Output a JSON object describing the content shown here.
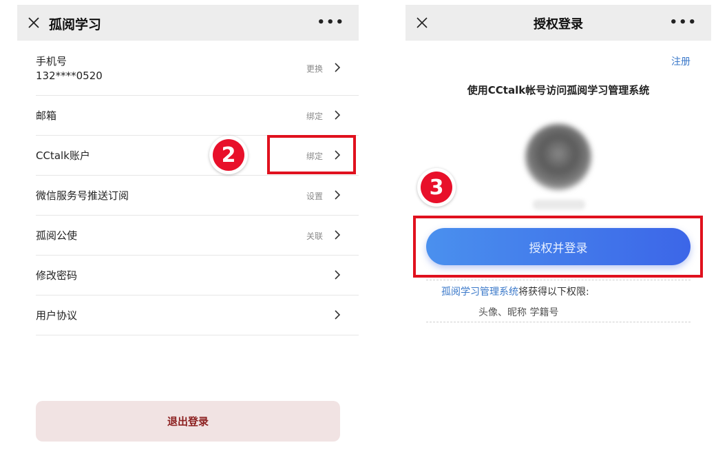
{
  "left": {
    "title": "孤阅学习",
    "more": "•••",
    "rows": [
      {
        "label": "手机号",
        "sub": "132****0520",
        "action": "更换"
      },
      {
        "label": "邮箱",
        "action": "绑定"
      },
      {
        "label": "CCtalk账户",
        "action": "绑定"
      },
      {
        "label": "微信服务号推送订阅",
        "action": "设置"
      },
      {
        "label": "孤阅公使",
        "action": "关联"
      },
      {
        "label": "修改密码",
        "action": ""
      },
      {
        "label": "用户协议",
        "action": ""
      }
    ],
    "logout": "退出登录",
    "step_badge": "2"
  },
  "right": {
    "title": "授权登录",
    "more": "•••",
    "register": "注册",
    "heading": "使用CCtalk帐号访问孤阅学习管理系统",
    "auth_button": "授权并登录",
    "perm_system": "孤阅学习管理系统",
    "perm_suffix": "将获得以下权限:",
    "perm_items": "头像、昵称 学籍号",
    "step_badge": "3"
  },
  "colors": {
    "highlight": "#e0111e",
    "badge": "#e8102a",
    "link": "#3a78c9",
    "auth_button_start": "#4a90ee",
    "auth_button_end": "#3c66e8",
    "logout_bg": "#f1e3e3",
    "logout_text": "#8c2020"
  },
  "icons": {
    "close": "close-icon",
    "more": "more-icon",
    "chevron": "chevron-right-icon"
  }
}
